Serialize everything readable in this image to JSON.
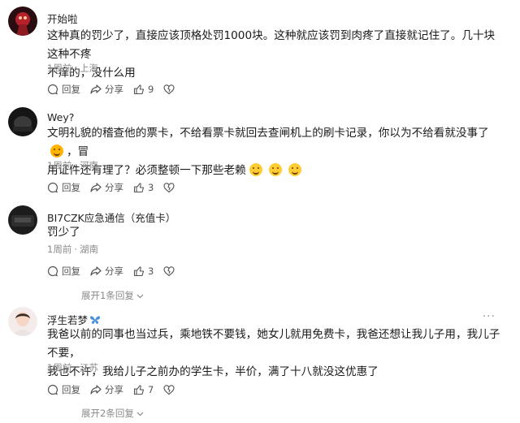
{
  "comments": [
    {
      "name": "开始啦",
      "line1": "这种真的罚少了，直接应该顶格处罚1000块。这种就应该罚到肉疼了直接就记住了。几十块这种不疼",
      "line2": "不痒的，没什么用",
      "time": "1周前",
      "location": "上海",
      "reply_label": "回复",
      "share_label": "分享",
      "likes": "9"
    },
    {
      "name": "Wey?",
      "line1": "文明礼貌的稽查他的票卡，不给看票卡就回去查闸机上的刷卡记录，你以为不给看就没事了",
      "line1_tail": "，冒",
      "line2": "用证件还有理了？必须整顿一下那些老赖",
      "time": "1周前",
      "location": "河南",
      "reply_label": "回复",
      "share_label": "分享",
      "likes": "3"
    },
    {
      "name": "BI7CZK应急通信（充值卡）",
      "line1": "罚少了",
      "time": "1周前",
      "location": "湖南",
      "reply_label": "回复",
      "share_label": "分享",
      "likes": "3",
      "expand_label": "展开1条回复"
    },
    {
      "name": "浮生若梦",
      "line1": "我爸以前的同事也当过兵，乘地铁不要钱，她女儿就用免费卡，我爸还想让我儿子用，我儿子不要，",
      "line2": "我也不许，我给儿子之前办的学生卡，半价，满了十八就没这优惠了",
      "time": "1周前",
      "location": "江苏",
      "reply_label": "回复",
      "share_label": "分享",
      "likes": "7",
      "expand_label": "展开2条回复",
      "more_label": "···"
    }
  ],
  "colors": {
    "text": "#1a1a1a",
    "meta": "#8a8a8a",
    "action": "#555555"
  }
}
